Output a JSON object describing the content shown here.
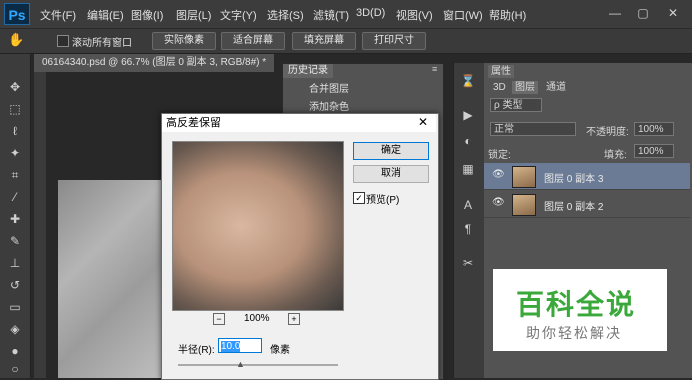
{
  "app": {
    "logo": "Ps"
  },
  "menu": [
    "文件(F)",
    "编辑(E)",
    "图像(I)",
    "图层(L)",
    "文字(Y)",
    "选择(S)",
    "滤镜(T)",
    "3D(D)",
    "视图(V)",
    "窗口(W)",
    "帮助(H)"
  ],
  "window_controls": {
    "minimize": "—",
    "restore": "▢",
    "close": "✕"
  },
  "options": {
    "scroll_all_label": "滚动所有窗口",
    "buttons": [
      "实际像素",
      "适合屏幕",
      "填充屏幕",
      "打印尺寸"
    ]
  },
  "document": {
    "tab_title": "06164340.psd @ 66.7% (图层 0 副本 3, RGB/8#) *"
  },
  "history": {
    "tab": "历史记录",
    "items": [
      "合并图层",
      "添加杂色"
    ]
  },
  "layers": {
    "tabs": [
      "3D",
      "图层",
      "通道"
    ],
    "properties_tab": "属性",
    "filter_kind": "ρ 类型",
    "blend_mode": "正常",
    "opacity_label": "不透明度:",
    "opacity_value": "100%",
    "lock_label": "锁定:",
    "fill_label": "填充:",
    "fill_value": "100%",
    "items": [
      "图层 0 副本 3",
      "图层 0 副本 2"
    ]
  },
  "dialog": {
    "title": "高反差保留",
    "close_icon": "✕",
    "ok": "确定",
    "cancel": "取消",
    "preview_label": "预览(P)",
    "preview_checked": true,
    "zoom_out": "−",
    "zoom_value": "100%",
    "zoom_in": "+",
    "radius_label": "半径(R):",
    "radius_value": "10.0",
    "radius_unit": "像素"
  },
  "watermark": {
    "title": "百科全说",
    "subtitle": "助你轻松解决"
  },
  "colors": {
    "accent": "#31a8ff",
    "watermark_green": "#3aa83a"
  }
}
